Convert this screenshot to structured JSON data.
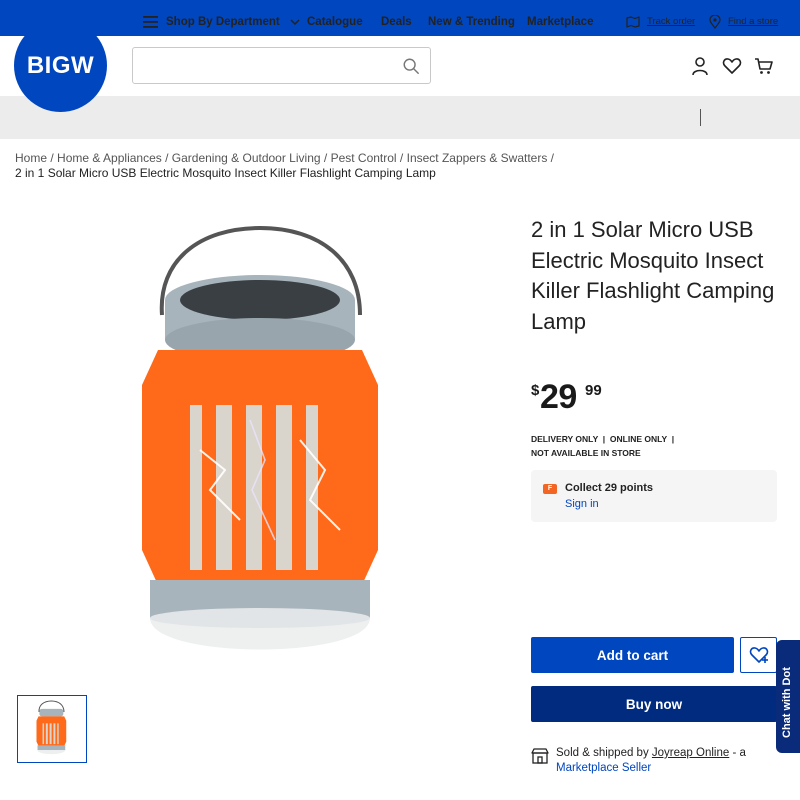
{
  "brand": {
    "logo_text": "BIGW",
    "primary_color": "#0046be",
    "dark_color": "#002b7f"
  },
  "search": {
    "placeholder": "",
    "value": "",
    "icon": "search-icon"
  },
  "header_icons": [
    "account-icon",
    "heart-icon",
    "cart-icon"
  ],
  "nav": {
    "department": "Shop By Department",
    "items": [
      "Catalogue",
      "Deals",
      "New & Trending",
      "Marketplace"
    ],
    "track_order": "Track order",
    "find_store": "Find a store"
  },
  "breadcrumb": {
    "items": [
      "Home",
      "Home & Appliances",
      "Gardening & Outdoor Living",
      "Pest Control",
      "Insect Zappers & Swatters"
    ],
    "separator": " / ",
    "current": "2 in 1 Solar Micro USB Electric Mosquito Insect Killer Flashlight Camping Lamp"
  },
  "product": {
    "title": "2 in 1 Solar Micro USB Electric Mosquito Insect Killer Flashlight Camping Lamp",
    "price": {
      "currency": "$",
      "dollars": "29",
      "cents": "99"
    },
    "availability_line1": "DELIVERY ONLY  |  ONLINE ONLY  |",
    "availability_line2": "NOT AVAILABLE IN STORE",
    "image_colors": {
      "body": "#ff6a1a",
      "cap": "#a8b4bc",
      "base": "#eef0f0"
    }
  },
  "rewards": {
    "icon_label": "F",
    "text": "Collect 29 points",
    "sign_in": "Sign in"
  },
  "actions": {
    "add_to_cart": "Add to cart",
    "buy_now": "Buy now"
  },
  "seller": {
    "prefix": "Sold & shipped by ",
    "name": "Joyreap Online",
    "middle": " - a ",
    "marketplace": "Marketplace Seller"
  },
  "chat": {
    "label": "Chat with Dot"
  }
}
